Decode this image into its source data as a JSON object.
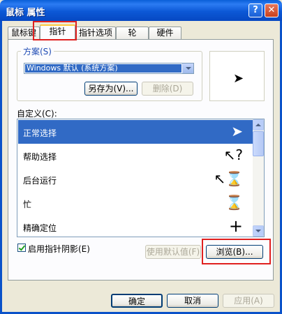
{
  "window": {
    "title": "鼠标 属性",
    "help_btn": "?",
    "close_btn": "✕"
  },
  "tabs": [
    {
      "label": "鼠标键"
    },
    {
      "label": "指针"
    },
    {
      "label": "指针选项"
    },
    {
      "label": "轮"
    },
    {
      "label": "硬件"
    }
  ],
  "scheme": {
    "legend": "方案(S)",
    "selected": "Windows 默认 (系统方案)",
    "save_as": "另存为(V)...",
    "delete": "删除(D)"
  },
  "customize": {
    "label": "自定义(C):",
    "items": [
      {
        "label": "正常选择",
        "icon": "arrow-cursor-icon",
        "glyph": "➤"
      },
      {
        "label": "帮助选择",
        "icon": "help-cursor-icon",
        "glyph": "↖?"
      },
      {
        "label": "后台运行",
        "icon": "working-cursor-icon",
        "glyph": "↖⌛"
      },
      {
        "label": "忙",
        "icon": "busy-hourglass-icon",
        "glyph": "⌛"
      },
      {
        "label": "精确定位",
        "icon": "crosshair-icon",
        "glyph": "+"
      }
    ]
  },
  "shadow_checkbox": {
    "label": "启用指针阴影(E)",
    "checked": true
  },
  "buttons": {
    "use_default": "使用默认值(F)",
    "browse": "浏览(B)...",
    "ok": "确定",
    "cancel": "取消",
    "apply": "应用(A)"
  },
  "colors": {
    "titlebar": "#0a5fd8",
    "selection": "#316ac5",
    "highlight_box": "#e0201f"
  }
}
